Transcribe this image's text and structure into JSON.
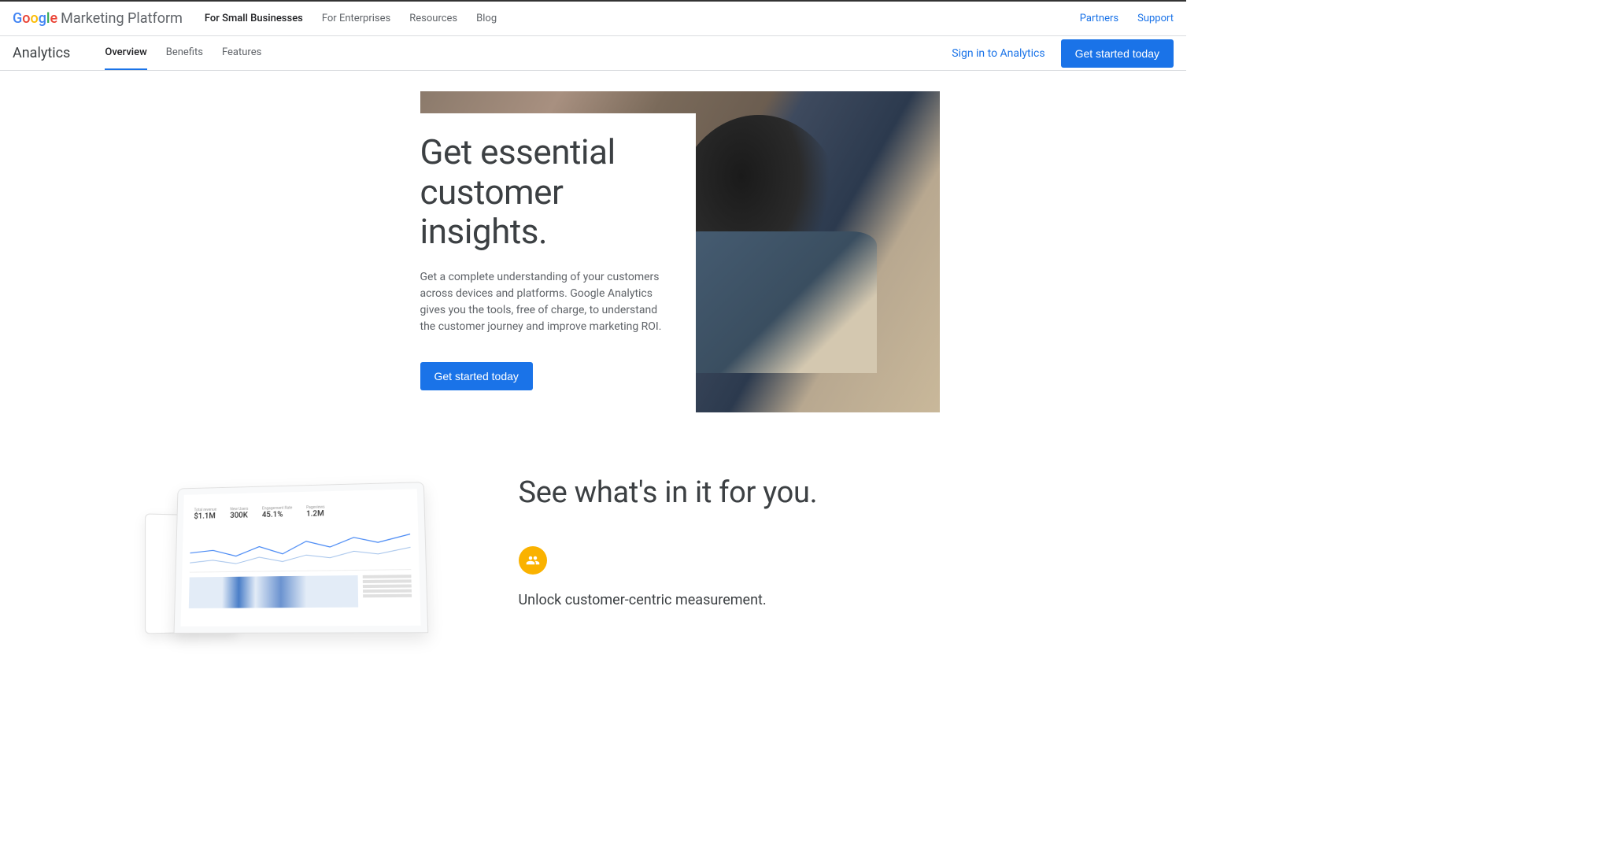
{
  "header": {
    "logo_brand_chars": [
      "G",
      "o",
      "o",
      "g",
      "l",
      "e"
    ],
    "logo_suffix": "Marketing Platform",
    "nav_primary": [
      {
        "label": "For Small Businesses",
        "active": true
      },
      {
        "label": "For Enterprises",
        "active": false
      },
      {
        "label": "Resources",
        "active": false
      },
      {
        "label": "Blog",
        "active": false
      }
    ],
    "right_links": [
      {
        "label": "Partners"
      },
      {
        "label": "Support"
      }
    ]
  },
  "subheader": {
    "product": "Analytics",
    "tabs": [
      {
        "label": "Overview",
        "active": true
      },
      {
        "label": "Benefits",
        "active": false
      },
      {
        "label": "Features",
        "active": false
      }
    ],
    "signin_label": "Sign in to Analytics",
    "cta_label": "Get started today"
  },
  "hero": {
    "title": "Get essential customer insights.",
    "description": "Get a complete understanding of your customers across devices and platforms. Google Analytics gives you the tools, free of charge, to understand the customer journey and improve marketing ROI.",
    "cta_label": "Get started today"
  },
  "benefits": {
    "title": "See what's in it for you.",
    "feature_title": "Unlock customer-centric measurement.",
    "dashboard_stats": [
      {
        "label": "Total revenue",
        "value": "$1.1M"
      },
      {
        "label": "New Users",
        "value": "300K"
      },
      {
        "label": "Engagement Rate",
        "value": "45.1%"
      },
      {
        "label": "Pageviews",
        "value": "1.2M"
      }
    ]
  },
  "colors": {
    "primary": "#1a73e8",
    "accent": "#fab200"
  }
}
